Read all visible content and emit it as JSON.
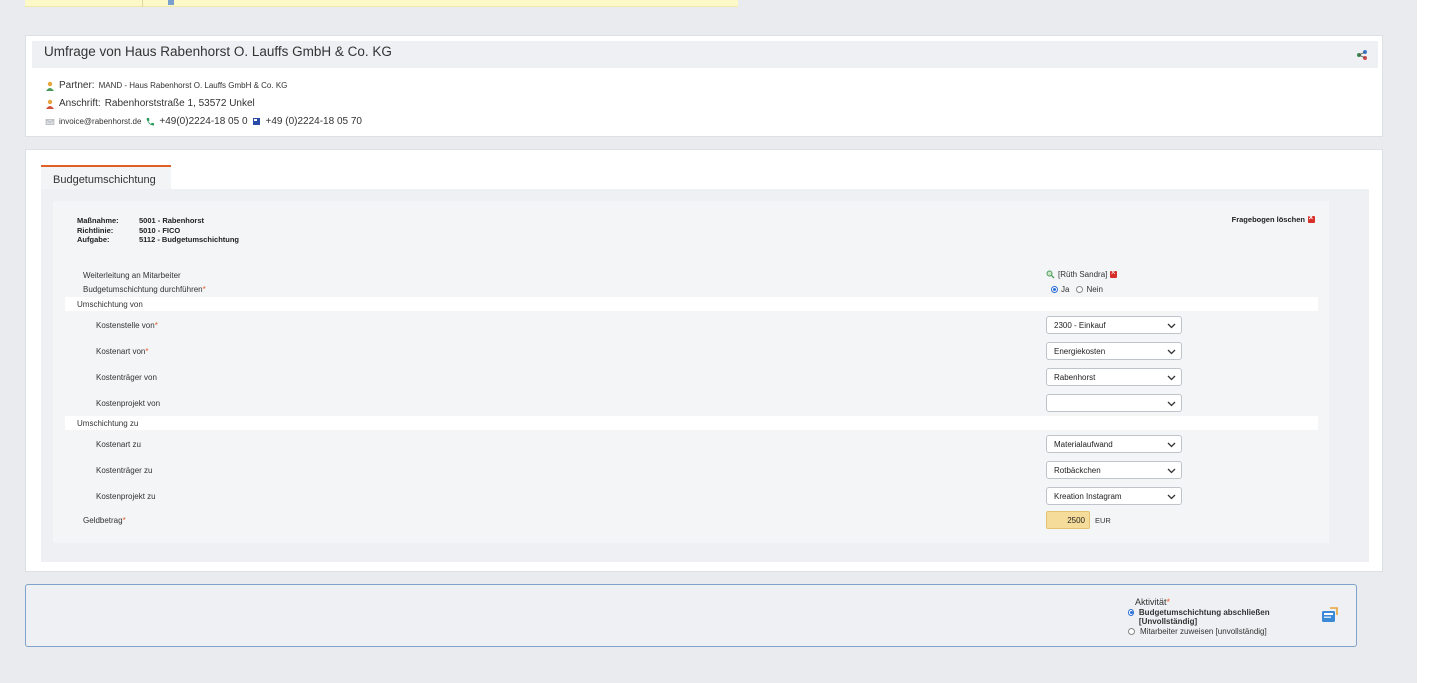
{
  "top_strip": {},
  "header": {
    "title": "Umfrage von Haus Rabenhorst O. Lauffs GmbH & Co. KG",
    "partner_label": "Partner:",
    "partner_value": "MAND - Haus Rabenhorst O. Lauffs GmbH & Co. KG",
    "address_label": "Anschrift:",
    "address_value": "Rabenhorststraße 1, 53572 Unkel",
    "email": "invoice@rabenhorst.de",
    "phone": "+49(0)2224-18 05 0",
    "fax": "+49 (0)2224-18 05 70"
  },
  "tab": {
    "label": "Budgetumschichtung"
  },
  "meta": {
    "massnahme_label": "Maßnahme:",
    "massnahme_value": "5001 - Rabenhorst",
    "richtlinie_label": "Richtlinie:",
    "richtlinie_value": "5010 - FICO",
    "aufgabe_label": "Aufgabe:",
    "aufgabe_value": "5112 - Budgetumschichtung",
    "delete_label": "Fragebogen löschen"
  },
  "form": {
    "forward_label": "Weiterleitung an Mitarbeiter",
    "forward_value": "[Rüth Sandra]",
    "execute_label": "Budgetumschichtung durchführen",
    "execute_yes": "Ja",
    "execute_no": "Nein",
    "execute_selected": "Ja",
    "section_from": "Umschichtung von",
    "kostenstelle_von_label": "Kostenstelle von",
    "kostenstelle_von_value": "2300 - Einkauf",
    "kostenart_von_label": "Kostenart von",
    "kostenart_von_value": "Energiekosten",
    "kostentraeger_von_label": "Kostenträger von",
    "kostentraeger_von_value": "Rabenhorst",
    "kostenprojekt_von_label": "Kostenprojekt von",
    "kostenprojekt_von_value": "",
    "section_to": "Umschichtung zu",
    "kostenart_zu_label": "Kostenart zu",
    "kostenart_zu_value": "Materialaufwand",
    "kostentraeger_zu_label": "Kostenträger zu",
    "kostentraeger_zu_value": "Rotbäckchen",
    "kostenprojekt_zu_label": "Kostenprojekt zu",
    "kostenprojekt_zu_value": "Kreation Instagram",
    "amount_label": "Geldbetrag",
    "amount_value": "2500",
    "currency": "EUR",
    "required_mark": "*"
  },
  "activity": {
    "title": "Aktivität",
    "option1": "Budgetumschichtung abschließen [Unvollständig]",
    "option2": "Mitarbeiter zuweisen [unvollständig]",
    "selected": "option1"
  },
  "colors": {
    "accent_orange": "#e0602a",
    "amount_bg": "#f6dc9a",
    "activity_border": "#7fa3c9",
    "radio_blue": "#2a6fd6"
  },
  "icons": [
    "share-icon",
    "partner-person-icon",
    "address-person-icon",
    "mail-icon",
    "phone-icon",
    "fax-icon",
    "delete-icon",
    "search-icon",
    "remove-icon",
    "chevron-down-icon",
    "submit-icon"
  ]
}
